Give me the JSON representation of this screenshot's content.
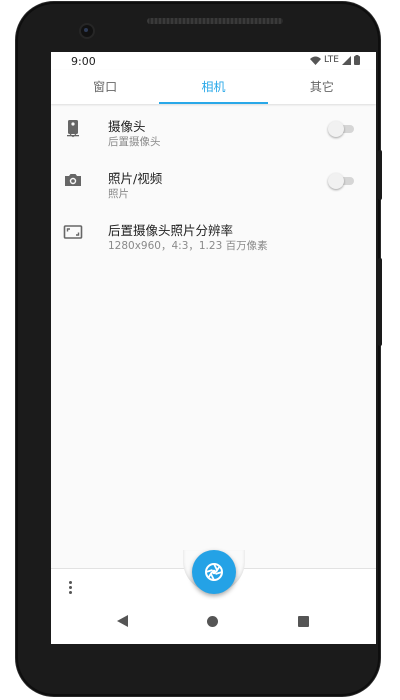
{
  "status_bar": {
    "time": "9:00",
    "network": "LTE"
  },
  "tabs": [
    {
      "label": "窗口",
      "active": false
    },
    {
      "label": "相机",
      "active": true
    },
    {
      "label": "其它",
      "active": false
    }
  ],
  "settings": [
    {
      "icon": "phone-camera-icon",
      "title": "摄像头",
      "subtitle": "后置摄像头",
      "has_toggle": true,
      "enabled": false
    },
    {
      "icon": "camera-icon",
      "title": "照片/视频",
      "subtitle": "照片",
      "has_toggle": true,
      "enabled": false
    },
    {
      "icon": "aspect-ratio-icon",
      "title": "后置摄像头照片分辨率",
      "subtitle": "1280x960，4:3，1.23 百万像素",
      "has_toggle": false
    }
  ],
  "fab": {
    "icon": "aperture-icon"
  },
  "colors": {
    "accent": "#29a8e8",
    "fab": "#24a2e6",
    "background": "#fafafa"
  }
}
